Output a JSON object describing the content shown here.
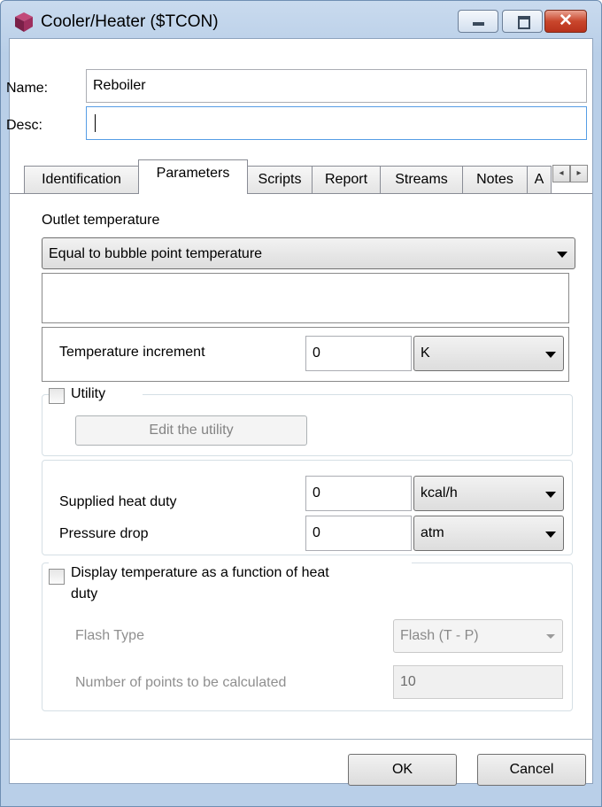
{
  "window": {
    "title": "Cooler/Heater ($TCON)",
    "app_icon": "simulis-cube-icon",
    "controls": {
      "minimize": "minimize-icon",
      "maximize": "maximize-icon",
      "close": "✕"
    }
  },
  "header": {
    "name_label": "Name:",
    "name_value": "Reboiler",
    "desc_label": "Desc:",
    "desc_value": ""
  },
  "tabs": [
    {
      "label": "Identification",
      "active": false
    },
    {
      "label": "Parameters",
      "active": true
    },
    {
      "label": "Scripts",
      "active": false
    },
    {
      "label": "Report",
      "active": false
    },
    {
      "label": "Streams",
      "active": false
    },
    {
      "label": "Notes",
      "active": false
    },
    {
      "label": "A",
      "active": false
    }
  ],
  "tab_scroll": {
    "left": "◂",
    "right": "▸"
  },
  "parameters": {
    "outlet_label": "Outlet temperature",
    "outlet_mode": "Equal to bubble point temperature",
    "temp_increment_label": "Temperature increment",
    "temp_increment_value": "0",
    "temp_increment_unit": "K",
    "utility_label": "Utility",
    "utility_checked": false,
    "edit_utility_label": "Edit the utility",
    "heat_duty_label": "Supplied heat duty",
    "heat_duty_value": "0",
    "heat_duty_unit": "kcal/h",
    "pressure_drop_label": "Pressure drop",
    "pressure_drop_value": "0",
    "pressure_drop_unit": "atm",
    "display_temp_label_1": "Display temperature as a function of heat",
    "display_temp_label_2": "duty",
    "display_temp_checked": false,
    "flash_type_label": "Flash Type",
    "flash_type_value": "Flash (T - P)",
    "points_label": "Number of points to be calculated",
    "points_value": "10"
  },
  "footer": {
    "ok_label": "OK",
    "cancel_label": "Cancel"
  },
  "colors": {
    "frame": "#b9cfe8",
    "close_button": "#c9462c",
    "focus_border": "#569de5"
  }
}
